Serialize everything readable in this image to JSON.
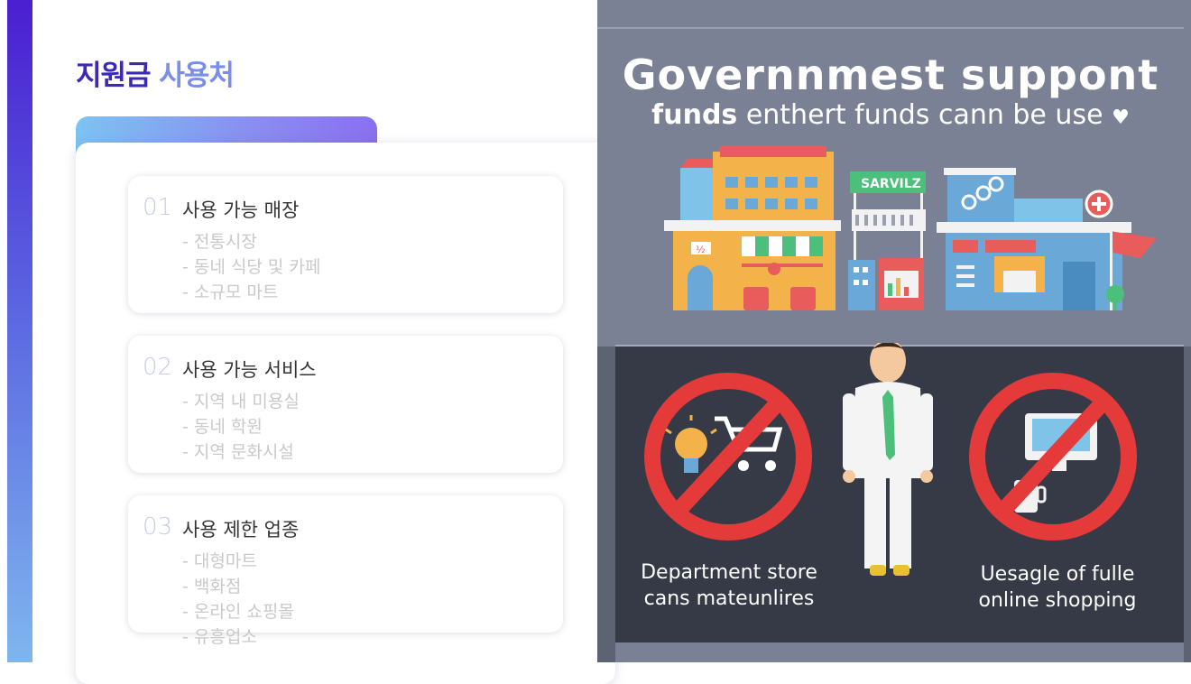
{
  "title": {
    "part1": "지원금",
    "part2": "사용처"
  },
  "sections": [
    {
      "num": "01",
      "head": "사용 가능 매장",
      "items": [
        "- 전통시장",
        "- 동네 식당 및 카페",
        "- 소규모 마트"
      ]
    },
    {
      "num": "02",
      "head": "사용 가능 서비스",
      "items": [
        "- 지역 내 미용실",
        "- 동네 학원",
        "- 지역 문화시설"
      ]
    },
    {
      "num": "03",
      "head": "사용 제한 업종",
      "items": [
        "- 대형마트",
        "- 백화점",
        "- 온라인 쇼핑몰",
        "- 유흥업소"
      ]
    }
  ],
  "infographic": {
    "headline": "Governnmest suppont",
    "subline_bold": "funds",
    "subline_rest": " enthert funds cann be use",
    "heart": "♥",
    "sign_text": "SARVILZ",
    "shop_sign": "½",
    "caption_left_1": "Department store",
    "caption_left_2": "cans mateunlires",
    "caption_right_1": "Uesagle of fulle",
    "caption_right_2": "online shopping"
  }
}
